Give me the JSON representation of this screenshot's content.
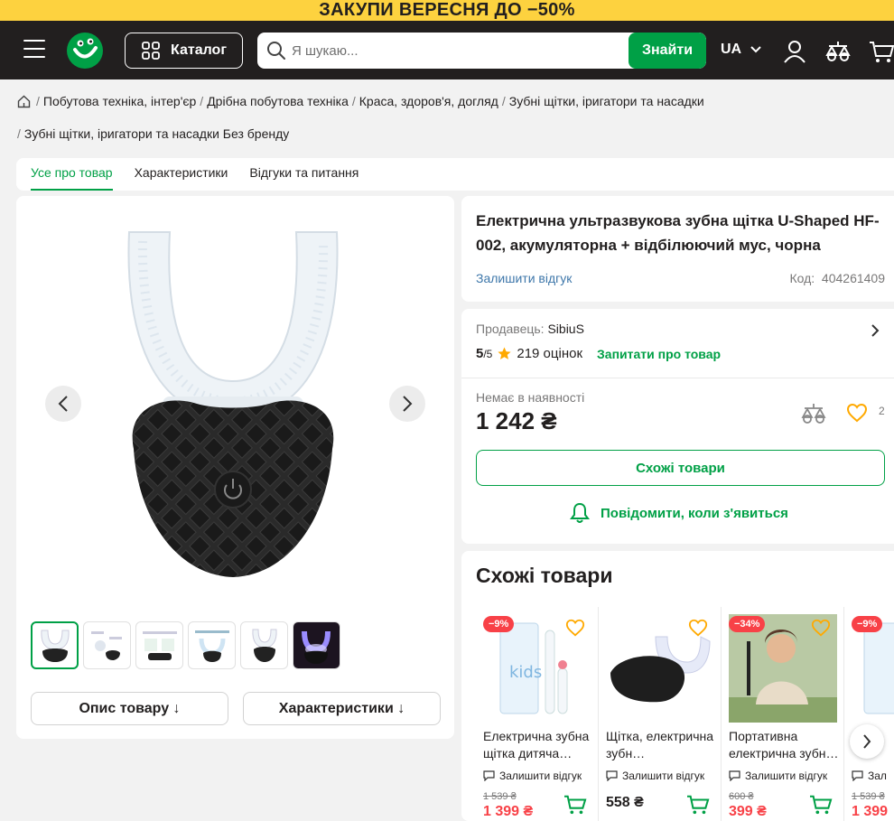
{
  "promo": {
    "text": "ЗАКУПИ ВЕРЕСНЯ ДО −50%"
  },
  "header": {
    "catalog_label": "Каталог",
    "search_placeholder": "Я шукаю...",
    "search_button": "Знайти",
    "language": "UA",
    "icons": [
      "menu-icon",
      "logo",
      "user-icon",
      "compare-icon",
      "cart-icon"
    ]
  },
  "breadcrumbs": {
    "row1": [
      "Побутова техніка, інтер'єр",
      "Дрібна побутова техніка",
      "Краса, здоров'я, догляд",
      "Зубні щітки, іригатори та насадки"
    ],
    "row2": [
      "Зубні щітки, іригатори та насадки Без бренду"
    ]
  },
  "tabs": [
    "Усе про товар",
    "Характеристики",
    "Відгуки та питання"
  ],
  "gallery": {
    "thumbnail_count": 6,
    "buttons": {
      "description": "Опис товару ↓",
      "characteristics": "Характеристики ↓"
    }
  },
  "product": {
    "title": "Електрична ультразвукова зубна щітка U-Shaped HF-002, акумуляторна + відбілюючий мус, чорна",
    "review_link": "Залишити відгук",
    "code_label": "Код:",
    "code": "404261409",
    "seller_label": "Продавець:",
    "seller": "SibiuS",
    "rating": "5",
    "rating_of": "/5",
    "rating_count": "219 оцінок",
    "ask_link": "Запитати про товар",
    "availability": "Немає в наявності",
    "price": "1 242 ₴",
    "wishlist_count": "2",
    "similar_button": "Схожі товари",
    "notify": "Повідомити, коли з'явиться"
  },
  "similar": {
    "title": "Схожі товари",
    "items": [
      {
        "badge": "−9%",
        "name": "Електрична зубна щітка дитяча…",
        "review": "Залишити відгук",
        "old_price": "1 539 ₴",
        "price": "1 399 ₴"
      },
      {
        "badge": "",
        "name": "Щітка, електрична зубн…",
        "review": "Залишити відгук",
        "old_price": "",
        "price": "558 ₴"
      },
      {
        "badge": "−34%",
        "name": "Портативна електрична зубн…",
        "review": "Залишити відгук",
        "old_price": "600 ₴",
        "price": "399 ₴"
      },
      {
        "badge": "−9%",
        "name": "Е",
        "review": "Зал",
        "old_price": "1 539 ₴",
        "price": "1 399"
      }
    ]
  },
  "colors": {
    "green": "#00a046",
    "dark": "#221f1f",
    "promo": "#fdd23f",
    "red": "#f84147",
    "link": "#3e77aa"
  }
}
